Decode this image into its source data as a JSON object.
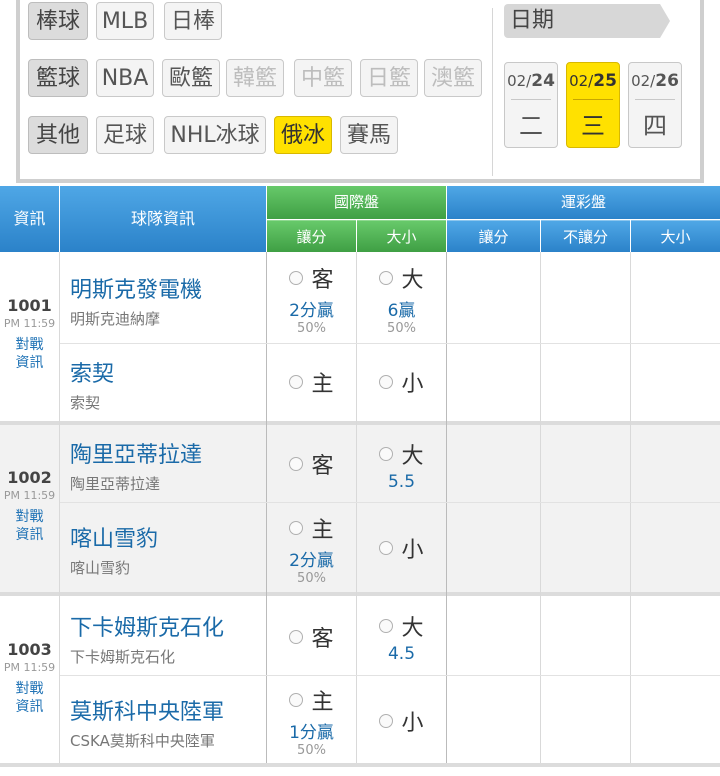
{
  "filters": {
    "row1": {
      "category": "棒球",
      "items": [
        "MLB",
        "日棒"
      ]
    },
    "row2": {
      "category": "籃球",
      "items": [
        "NBA",
        "歐籃",
        "韓籃",
        "中籃",
        "日籃",
        "澳籃"
      ]
    },
    "row3": {
      "category": "其他",
      "items": [
        "足球",
        "NHL冰球",
        "俄冰",
        "賽馬"
      ]
    },
    "active": "俄冰"
  },
  "date": {
    "label": "日期",
    "days": [
      {
        "month": "02/",
        "day": "24",
        "weekday": "二"
      },
      {
        "month": "02/",
        "day": "25",
        "weekday": "三"
      },
      {
        "month": "02/",
        "day": "26",
        "weekday": "四"
      }
    ],
    "active_index": 1
  },
  "header": {
    "info": "資訊",
    "team_info": "球隊資訊",
    "intl": "國際盤",
    "intl_handicap": "讓分",
    "intl_ou": "大小",
    "lottery": "運彩盤",
    "lot_handicap": "讓分",
    "lot_nohandicap": "不讓分",
    "lot_ou": "大小"
  },
  "matches": [
    {
      "no": "1001",
      "time": "PM 11:59",
      "link": [
        "對戰",
        "資訊"
      ],
      "away": {
        "name": "明斯克發電機",
        "sub": "明斯克迪納摩"
      },
      "home": {
        "name": "索契",
        "sub": "索契"
      },
      "handicap": {
        "away_label": "客",
        "home_label": "主",
        "line": "2分贏",
        "pct": "50%",
        "on": "away"
      },
      "ou": {
        "over_label": "大",
        "under_label": "小",
        "line": "6贏",
        "pct": "50%"
      }
    },
    {
      "no": "1002",
      "time": "PM 11:59",
      "link": [
        "對戰",
        "資訊"
      ],
      "away": {
        "name": "陶里亞蒂拉達",
        "sub": "陶里亞蒂拉達"
      },
      "home": {
        "name": "喀山雪豹",
        "sub": "喀山雪豹"
      },
      "handicap": {
        "away_label": "客",
        "home_label": "主",
        "line": "2分贏",
        "pct": "50%",
        "on": "home"
      },
      "ou": {
        "over_label": "大",
        "under_label": "小",
        "line": "5.5",
        "pct": ""
      }
    },
    {
      "no": "1003",
      "time": "PM 11:59",
      "link": [
        "對戰",
        "資訊"
      ],
      "away": {
        "name": "下卡姆斯克石化",
        "sub": "下卡姆斯克石化"
      },
      "home": {
        "name": "莫斯科中央陸軍",
        "sub": "CSKA莫斯科中央陸軍"
      },
      "handicap": {
        "away_label": "客",
        "home_label": "主",
        "line": "1分贏",
        "pct": "50%",
        "on": "home"
      },
      "ou": {
        "over_label": "大",
        "under_label": "小",
        "line": "4.5",
        "pct": ""
      }
    }
  ]
}
